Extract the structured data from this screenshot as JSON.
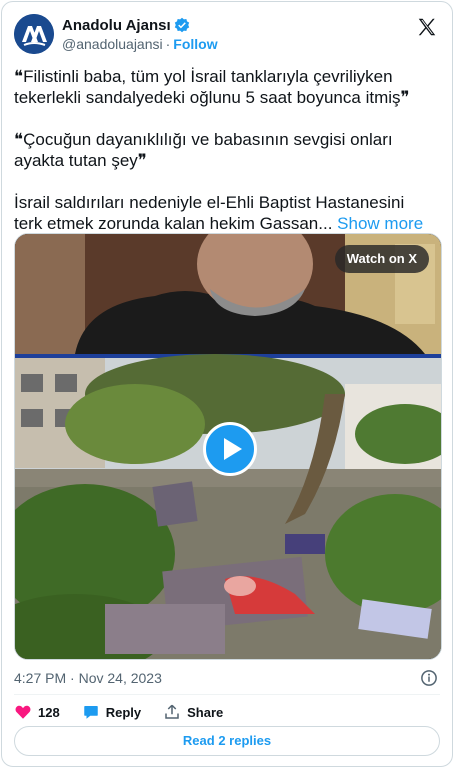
{
  "author": {
    "name": "Anadolu Ajansı",
    "handle": "@anadoluajansi",
    "separator": "·",
    "follow_label": "Follow",
    "verified": true
  },
  "tweet": {
    "paragraphs": [
      "❝Filistinli baba, tüm yol İsrail tanklarıyla çevriliyken tekerlekli sandalyedeki oğlunu 5 saat boyunca itmiş❞",
      "❝Çocuğun dayanıklılığı ve babasının sevgisi onları ayakta tutan şey❞",
      "İsrail saldırıları nedeniyle el-Ehli Baptist Hastanesini terk etmek zorunda kalan hekim Gassan..."
    ],
    "show_more_label": "Show more"
  },
  "media": {
    "watch_label": "Watch on X"
  },
  "meta": {
    "timestamp": "4:27 PM · Nov 24, 2023"
  },
  "actions": {
    "like_count": "128",
    "reply_label": "Reply",
    "share_label": "Share"
  },
  "replies": {
    "label": "Read 2 replies"
  },
  "colors": {
    "accent": "#1d9bf0",
    "like": "#f91880",
    "brand_blue": "#1a4a8f"
  },
  "icons": [
    "aa-logo-avatar",
    "verified-badge-icon",
    "x-logo-icon",
    "play-icon",
    "info-icon",
    "heart-icon",
    "reply-icon",
    "share-icon"
  ]
}
